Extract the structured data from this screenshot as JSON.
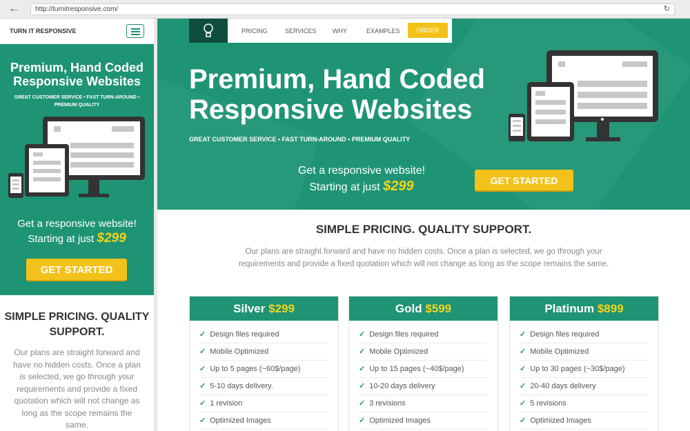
{
  "browser": {
    "url": "http://turnitresponsive.com/"
  },
  "mobile": {
    "brand": "TURN IT RESPONSIVE",
    "hero_title": "Premium, Hand Coded Responsive Websites",
    "hero_sub": "GREAT CUSTOMER SERVICE • FAST TURN-AROUND • PREMIUM QUALITY",
    "cta_line1": "Get a responsive website!",
    "cta_line2": "Starting at just",
    "cta_price": "$299",
    "cta_button": "GET STARTED",
    "pricing_title": "SIMPLE PRICING. QUALITY SUPPORT.",
    "pricing_text": "Our plans are straight forward and have no hidden costs. Once a plan is selected, we go through your requirements and provide a fixed quotation which will not change as long as the scope remains the same."
  },
  "nav": {
    "items": [
      "PRICING",
      "SERVICES",
      "WHY",
      "EXAMPLES"
    ],
    "order": "ORDER"
  },
  "hero": {
    "title_line1": "Premium, Hand Coded",
    "title_line2": "Responsive Websites",
    "subtitle": "GREAT CUSTOMER SERVICE • FAST TURN-AROUND • PREMIUM QUALITY",
    "cta_line1": "Get a responsive website!",
    "cta_line2": "Starting at just",
    "cta_price": "$299",
    "button": "GET STARTED"
  },
  "pricing": {
    "title": "SIMPLE PRICING. QUALITY SUPPORT.",
    "text": "Our plans are straight forward and have no hidden costs. Once a plan is selected, we go through your requirements and provide a fixed quotation which will not change as long as the scope remains the same.",
    "plans": [
      {
        "name": "Silver",
        "price": "$299",
        "features": [
          "Design files required",
          "Mobile Optimized",
          "Up to 5 pages (~60$/page)",
          "5-10 days delivery.",
          "1 revision",
          "Optimized Images"
        ]
      },
      {
        "name": "Gold",
        "price": "$599",
        "features": [
          "Design files required",
          "Mobile Optimized",
          "Up to 15 pages (~40$/page)",
          "10-20 days delivery",
          "3 revisions",
          "Optimized Images"
        ]
      },
      {
        "name": "Platinum",
        "price": "$899",
        "features": [
          "Design files required",
          "Mobile Optimized",
          "Up to 30 pages (~30$/page)",
          "20-40 days delivery",
          "5 revisions",
          "Optimized Images"
        ]
      }
    ]
  },
  "colors": {
    "brand_green": "#1f9474",
    "accent_yellow": "#f3c21a",
    "price_yellow": "#f6d31e"
  }
}
